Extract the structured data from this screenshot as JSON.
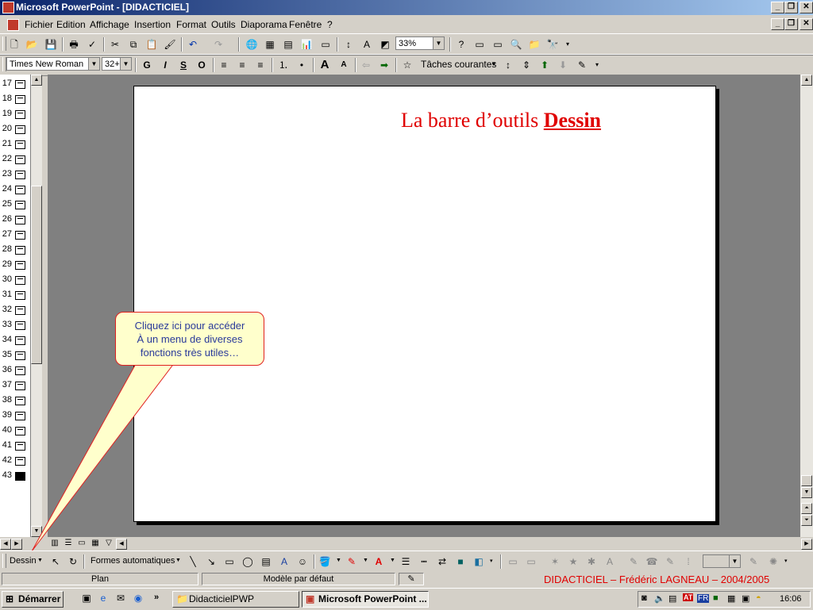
{
  "window": {
    "title": "Microsoft PowerPoint - [DIDACTICIEL]"
  },
  "menu": {
    "items": [
      "Fichier",
      "Edition",
      "Affichage",
      "Insertion",
      "Format",
      "Outils",
      "Diaporama",
      "Fenêtre",
      "?"
    ]
  },
  "standard_toolbar": {
    "zoom": "33%"
  },
  "format_toolbar": {
    "font": "Times New Roman",
    "size": "32+",
    "bold": "G",
    "italic": "I",
    "underline": "S",
    "shadow": "O",
    "common_tasks": "Tâches courantes"
  },
  "outline": {
    "slides": [
      "17",
      "18",
      "19",
      "20",
      "21",
      "22",
      "23",
      "24",
      "25",
      "26",
      "27",
      "28",
      "29",
      "30",
      "31",
      "32",
      "33",
      "34",
      "35",
      "36",
      "37",
      "38",
      "39",
      "40",
      "41",
      "42",
      "43"
    ],
    "selected": "43"
  },
  "slide": {
    "title_prefix": "La barre d’outils ",
    "title_emph": "Dessin"
  },
  "callout": {
    "line1": "Cliquez ici pour accéder",
    "line2": "À un menu de diverses",
    "line3": "fonctions très utiles…"
  },
  "drawing_toolbar": {
    "draw_menu": "Dessin",
    "autoshapes": "Formes automatiques"
  },
  "status": {
    "view": "Plan",
    "design": "Modèle par défaut",
    "footer": "DIDACTICIEL – Frédéric LAGNEAU – 2004/2005"
  },
  "taskbar": {
    "start": "Démarrer",
    "task1": "DidacticielPWP",
    "task2": "Microsoft PowerPoint ...",
    "lang": "FR",
    "clock": "16:06"
  },
  "colors": {
    "title_red": "#e00000",
    "callout_text": "#2a3a9a",
    "callout_fill": "#ffffcc",
    "status_footer": "#e00000"
  }
}
